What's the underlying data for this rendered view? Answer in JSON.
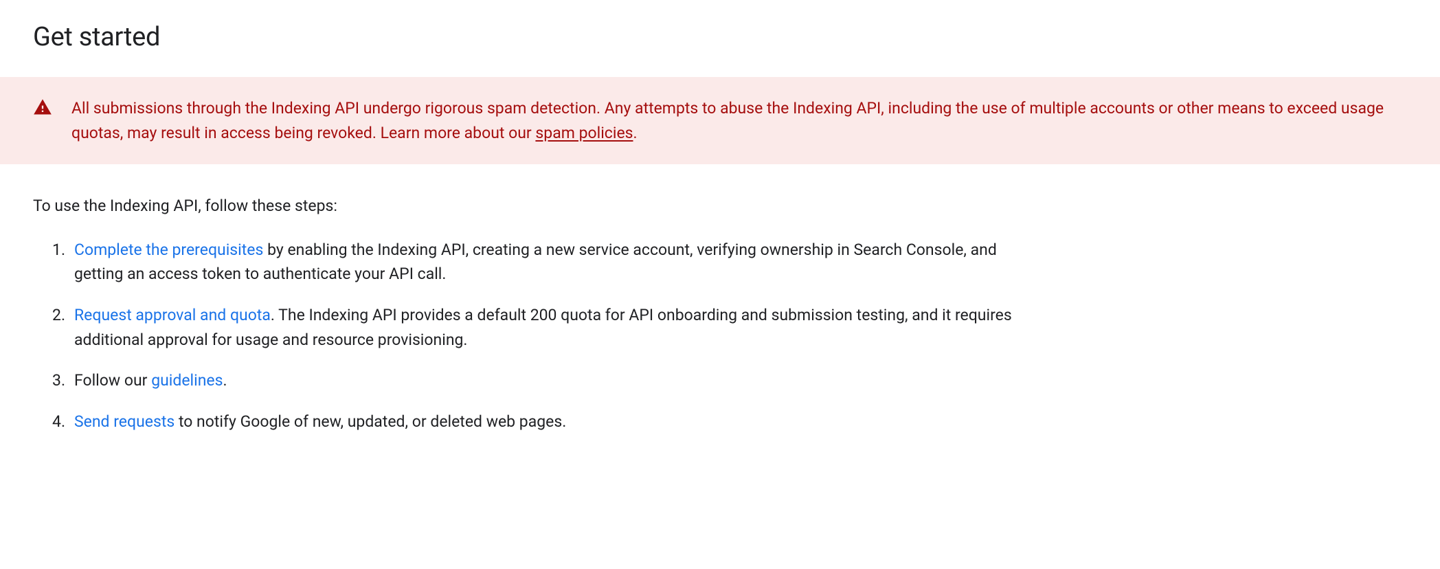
{
  "heading": "Get started",
  "warning": {
    "text_before_link": "All submissions through the Indexing API undergo rigorous spam detection. Any attempts to abuse the Indexing API, including the use of multiple accounts or other means to exceed usage quotas, may result in access being revoked. Learn more about our ",
    "link_text": "spam policies",
    "text_after_link": "."
  },
  "intro": "To use the Indexing API, follow these steps:",
  "steps": [
    {
      "link": "Complete the prerequisites",
      "after": " by enabling the Indexing API, creating a new service account, verifying ownership in Search Console, and getting an access token to authenticate your API call."
    },
    {
      "link": "Request approval and quota",
      "after": ". The Indexing API provides a default 200 quota for API onboarding and submission testing, and it requires additional approval for usage and resource provisioning."
    },
    {
      "before": "Follow our ",
      "link": "guidelines",
      "after": "."
    },
    {
      "link": "Send requests",
      "after": " to notify Google of new, updated, or deleted web pages."
    }
  ]
}
